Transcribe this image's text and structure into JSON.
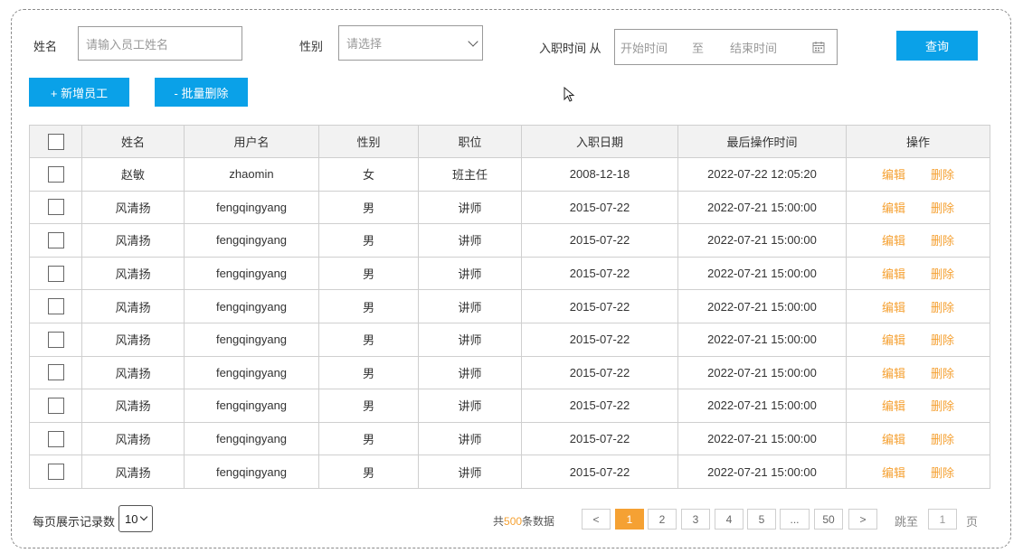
{
  "search": {
    "name_label": "姓名",
    "name_placeholder": "请输入员工姓名",
    "gender_label": "性别",
    "gender_placeholder": "请选择",
    "date_label": "入职时间 从",
    "date_start_placeholder": "开始时间",
    "date_sep": "至",
    "date_end_placeholder": "结束时间",
    "query_button": "查询"
  },
  "actions": {
    "add_button": "+ 新增员工",
    "batch_delete_button": "- 批量删除"
  },
  "table": {
    "headers": [
      "",
      "姓名",
      "用户名",
      "性别",
      "职位",
      "入职日期",
      "最后操作时间",
      "操作"
    ],
    "edit_label": "编辑",
    "delete_label": "删除",
    "rows": [
      {
        "name": "赵敏",
        "username": "zhaomin",
        "gender": "女",
        "position": "班主任",
        "hire_date": "2008-12-18",
        "last_op": "2022-07-22 12:05:20"
      },
      {
        "name": "风清扬",
        "username": "fengqingyang",
        "gender": "男",
        "position": "讲师",
        "hire_date": "2015-07-22",
        "last_op": "2022-07-21 15:00:00"
      },
      {
        "name": "风清扬",
        "username": "fengqingyang",
        "gender": "男",
        "position": "讲师",
        "hire_date": "2015-07-22",
        "last_op": "2022-07-21 15:00:00"
      },
      {
        "name": "风清扬",
        "username": "fengqingyang",
        "gender": "男",
        "position": "讲师",
        "hire_date": "2015-07-22",
        "last_op": "2022-07-21 15:00:00"
      },
      {
        "name": "风清扬",
        "username": "fengqingyang",
        "gender": "男",
        "position": "讲师",
        "hire_date": "2015-07-22",
        "last_op": "2022-07-21 15:00:00"
      },
      {
        "name": "风清扬",
        "username": "fengqingyang",
        "gender": "男",
        "position": "讲师",
        "hire_date": "2015-07-22",
        "last_op": "2022-07-21 15:00:00"
      },
      {
        "name": "风清扬",
        "username": "fengqingyang",
        "gender": "男",
        "position": "讲师",
        "hire_date": "2015-07-22",
        "last_op": "2022-07-21 15:00:00"
      },
      {
        "name": "风清扬",
        "username": "fengqingyang",
        "gender": "男",
        "position": "讲师",
        "hire_date": "2015-07-22",
        "last_op": "2022-07-21 15:00:00"
      },
      {
        "name": "风清扬",
        "username": "fengqingyang",
        "gender": "男",
        "position": "讲师",
        "hire_date": "2015-07-22",
        "last_op": "2022-07-21 15:00:00"
      },
      {
        "name": "风清扬",
        "username": "fengqingyang",
        "gender": "男",
        "position": "讲师",
        "hire_date": "2015-07-22",
        "last_op": "2022-07-21 15:00:00"
      }
    ]
  },
  "footer": {
    "per_page_label": "每页展示记录数",
    "per_page_value": "10",
    "total_prefix": "共",
    "total_count": "500",
    "total_suffix": "条数据",
    "prev": "<",
    "next": ">",
    "pages": [
      "1",
      "2",
      "3",
      "4",
      "5",
      "...",
      "50"
    ],
    "current_page": "1",
    "jump_label": "跳至",
    "jump_value": "1",
    "jump_suffix": "页"
  },
  "colors": {
    "primary": "#0aa1e8",
    "accent": "#f5a133",
    "header_bg": "#f2f2f2"
  }
}
